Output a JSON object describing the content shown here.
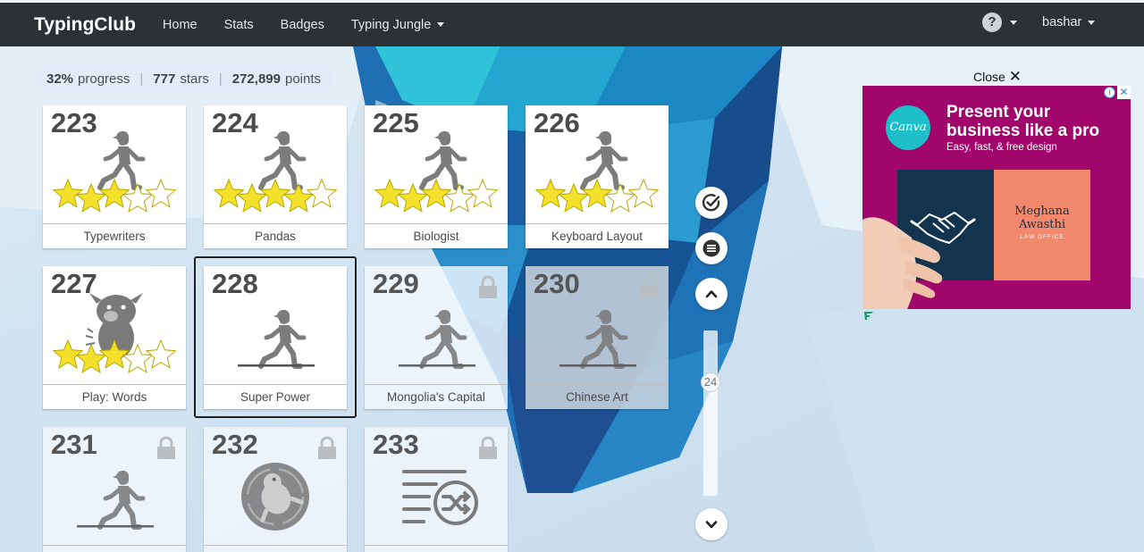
{
  "nav": {
    "brand": "TypingClub",
    "links": [
      "Home",
      "Stats",
      "Badges",
      "Typing Jungle"
    ],
    "help_label": "?",
    "user": "bashar"
  },
  "progress": {
    "percent": "32%",
    "percent_label": "progress",
    "stars": "777",
    "stars_label": "stars",
    "points": "272,899",
    "points_label": "points"
  },
  "lessons": [
    {
      "number": "223",
      "title": "Typewriters",
      "stars_earned": 3,
      "stars_total": 5,
      "locked": false,
      "icon": "runner-icon"
    },
    {
      "number": "224",
      "title": "Pandas",
      "stars_earned": 4,
      "stars_total": 5,
      "locked": false,
      "icon": "runner-icon"
    },
    {
      "number": "225",
      "title": "Biologist",
      "stars_earned": 3,
      "stars_total": 5,
      "locked": false,
      "icon": "runner-icon"
    },
    {
      "number": "226",
      "title": "Keyboard Layout",
      "stars_earned": 3,
      "stars_total": 5,
      "locked": false,
      "icon": "runner-icon"
    },
    {
      "number": "227",
      "title": "Play: Words",
      "stars_earned": 3,
      "stars_total": 5,
      "locked": false,
      "icon": "creature-icon"
    },
    {
      "number": "228",
      "title": "Super Power",
      "stars_earned": 0,
      "stars_total": 5,
      "locked": false,
      "selected": true,
      "icon": "runner-icon"
    },
    {
      "number": "229",
      "title": "Mongolia's Capital",
      "stars_earned": 0,
      "stars_total": 5,
      "locked": true,
      "icon": "runner-icon"
    },
    {
      "number": "230",
      "title": "Chinese Art",
      "stars_earned": 0,
      "stars_total": 5,
      "locked": true,
      "icon": "runner-icon"
    },
    {
      "number": "231",
      "title": "",
      "stars_earned": 0,
      "stars_total": 5,
      "locked": true,
      "icon": "runner-icon"
    },
    {
      "number": "232",
      "title": "",
      "stars_earned": 0,
      "stars_total": 5,
      "locked": true,
      "icon": "game-badge-icon"
    },
    {
      "number": "233",
      "title": "",
      "stars_earned": 0,
      "stars_total": 5,
      "locked": true,
      "icon": "shuffle-list-icon"
    }
  ],
  "side_controls": {
    "slider_value": "24"
  },
  "ad": {
    "close_label": "Close",
    "close_symbol": "✕",
    "logo_text": "Canva",
    "headline_line1": "Present your",
    "headline_line2": "business like a pro",
    "subline": "Easy, fast, & free design",
    "card_name_line1": "Meghana",
    "card_name_line2": "Awasthi",
    "card_tagline": "LAW OFFICE",
    "info_symbol": "i",
    "x_symbol": "✕"
  },
  "colors": {
    "navbar": "#2c3136",
    "star_fill": "#f2e02a",
    "ad_background": "#a1066b",
    "canva_teal": "#1fbfca"
  }
}
